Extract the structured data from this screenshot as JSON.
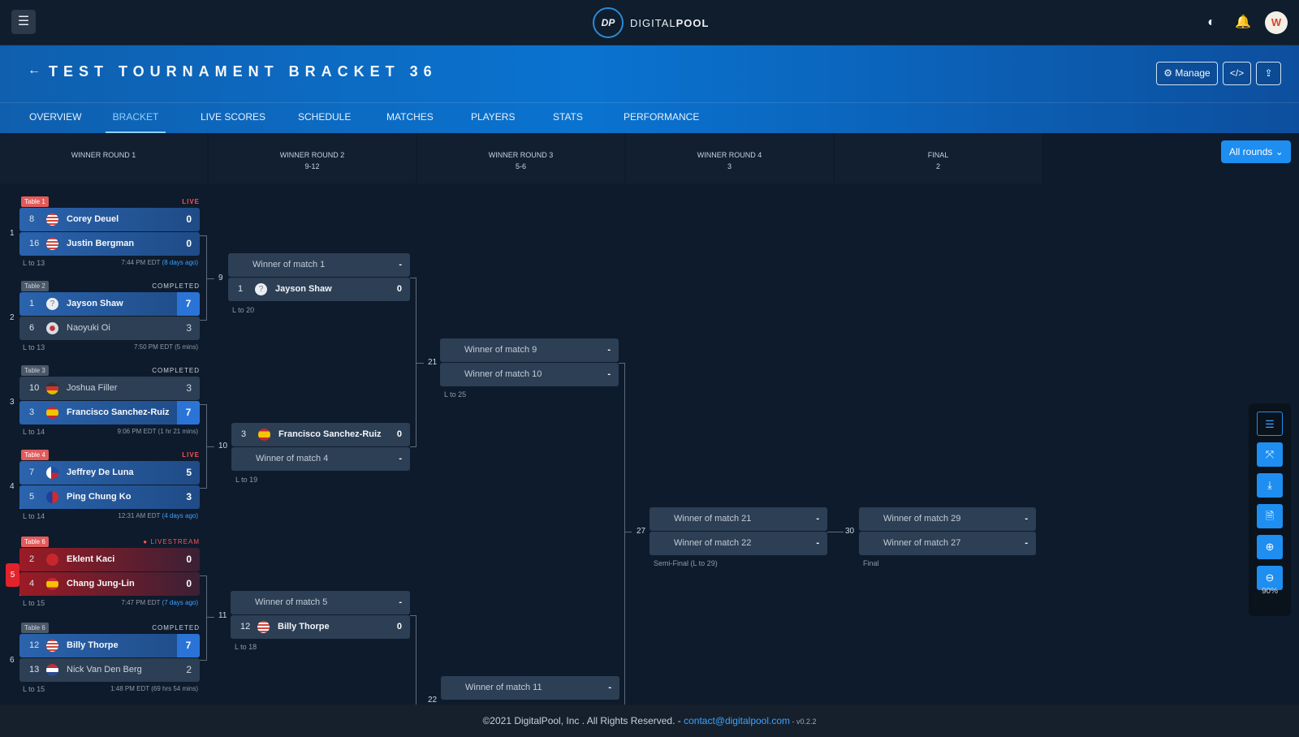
{
  "topbar": {
    "logo_mark": "DP",
    "logo_text_a": "DIGITAL",
    "logo_text_b": "POOL",
    "menu_icon": "☰",
    "theme_icon": "◐",
    "bell_icon": "🔔",
    "avatar": "W"
  },
  "header": {
    "back_icon": "←",
    "title": "TEST TOURNAMENT BRACKET 36",
    "manage_label": "⚙ Manage",
    "embed_label": "</>",
    "share_label": "⇪"
  },
  "tabs": [
    "OVERVIEW",
    "BRACKET",
    "LIVE SCORES",
    "SCHEDULE",
    "MATCHES",
    "PLAYERS",
    "STATS",
    "PERFORMANCE"
  ],
  "active_tab": "BRACKET",
  "rounds": [
    {
      "name": "WINNER ROUND 1",
      "sub": ""
    },
    {
      "name": "WINNER ROUND 2",
      "sub": "9-12"
    },
    {
      "name": "WINNER ROUND 3",
      "sub": "5-6"
    },
    {
      "name": "WINNER ROUND 4",
      "sub": "3"
    },
    {
      "name": "FINAL",
      "sub": "2"
    }
  ],
  "rounds_select": "All rounds ⌄",
  "round1": [
    {
      "num": "1",
      "table": "Table 1",
      "status": "LIVE",
      "p1": {
        "seed": "8",
        "name": "Corey Deuel",
        "score": "0"
      },
      "p2": {
        "seed": "16",
        "name": "Justin Bergman",
        "score": "0"
      },
      "loser": "L to 13",
      "time": "7:44 PM EDT",
      "ago": "(8 days ago)"
    },
    {
      "num": "2",
      "table": "Table 2",
      "status": "COMPLETED",
      "p1": {
        "seed": "1",
        "name": "Jayson Shaw",
        "score": "7"
      },
      "p2": {
        "seed": "6",
        "name": "Naoyuki Oi",
        "score": "3"
      },
      "loser": "L to 13",
      "time": "7:50 PM EDT",
      "ago": "(5 mins)"
    },
    {
      "num": "3",
      "table": "Table 3",
      "status": "COMPLETED",
      "p1": {
        "seed": "10",
        "name": "Joshua Filler",
        "score": "3"
      },
      "p2": {
        "seed": "3",
        "name": "Francisco Sanchez-Ruiz",
        "score": "7"
      },
      "loser": "L to 14",
      "time": "9:06 PM EDT",
      "ago": "(1 hr 21 mins)"
    },
    {
      "num": "4",
      "table": "Table 4",
      "status": "LIVE",
      "p1": {
        "seed": "7",
        "name": "Jeffrey De Luna",
        "score": "5"
      },
      "p2": {
        "seed": "5",
        "name": "Ping Chung Ko",
        "score": "3"
      },
      "loser": "L to 14",
      "time": "12:31 AM EDT",
      "ago": "(4 days ago)"
    },
    {
      "num": "5",
      "table": "Table 6",
      "status": "● LIVESTREAM",
      "p1": {
        "seed": "2",
        "name": "Eklent Kaci",
        "score": "0"
      },
      "p2": {
        "seed": "4",
        "name": "Chang Jung-Lin",
        "score": "0"
      },
      "loser": "L to 15",
      "time": "7:47 PM EDT",
      "ago": "(7 days ago)"
    },
    {
      "num": "6",
      "table": "Table 6",
      "status": "COMPLETED",
      "p1": {
        "seed": "12",
        "name": "Billy Thorpe",
        "score": "7"
      },
      "p2": {
        "seed": "13",
        "name": "Nick Van Den Berg",
        "score": "2"
      },
      "loser": "L to 15",
      "time": "1:48 PM EDT",
      "ago": "(69 hrs 54 mins)"
    }
  ],
  "round2": [
    {
      "num": "9",
      "top": "Winner of match 1",
      "top_score": "-",
      "seed": "1",
      "name": "Jayson Shaw",
      "score": "0",
      "loser": "L to 20"
    },
    {
      "num": "10",
      "seed": "3",
      "name": "Francisco Sanchez-Ruiz",
      "score": "0",
      "bottom": "Winner of match 4",
      "bottom_score": "-",
      "loser": "L to 19"
    },
    {
      "num": "11",
      "top": "Winner of match 5",
      "top_score": "-",
      "seed": "12",
      "name": "Billy Thorpe",
      "score": "0",
      "loser": "L to 18"
    }
  ],
  "round3": [
    {
      "num": "21",
      "top": "Winner of match 9",
      "top_score": "-",
      "bottom": "Winner of match 10",
      "bottom_score": "-",
      "loser": "L to 25"
    },
    {
      "num": "22",
      "top": "Winner of match 11",
      "top_score": "-"
    }
  ],
  "round4": {
    "num": "27",
    "top": "Winner of match 21",
    "top_score": "-",
    "bottom": "Winner of match 22",
    "bottom_score": "-",
    "label": "Semi-Final (L to 29)"
  },
  "final": {
    "num": "30",
    "top": "Winner of match 29",
    "top_score": "-",
    "bottom": "Winner of match 27",
    "bottom_score": "-",
    "label": "Final"
  },
  "tools": {
    "list_icon": "☰",
    "fullscreen_icon": "⤧",
    "download_icon": "⤓",
    "pdf_icon": "🗎",
    "zoom_in_icon": "⊕",
    "zoom_out_icon": "⊖",
    "zoom_level": "90%"
  },
  "footer": {
    "copy": "©2021 DigitalPool, Inc . All Rights Reserved. - ",
    "email": "contact@digitalpool.com",
    "version": " - v0.2.2"
  },
  "colors": {
    "accent": "#1e8ef0",
    "live": "#ff4f4f",
    "win": "#2a74d8"
  }
}
